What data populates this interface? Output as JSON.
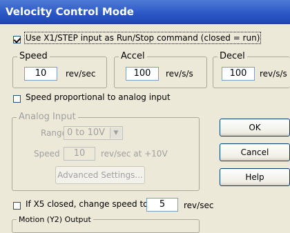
{
  "window": {
    "title": "Velocity Control Mode"
  },
  "run_stop": {
    "label": "Use X1/STEP input as Run/Stop command (closed = run)",
    "checked": true
  },
  "speed": {
    "legend": "Speed",
    "value": "10",
    "unit": "rev/sec"
  },
  "accel": {
    "legend": "Accel",
    "value": "100",
    "unit": "rev/s/s"
  },
  "decel": {
    "legend": "Decel",
    "value": "100",
    "unit": "rev/s/s"
  },
  "speed_analog": {
    "label": "Speed proportional to analog input",
    "checked": false
  },
  "analog_input": {
    "legend": "Analog Input",
    "range_label": "Range",
    "range_value": "0 to 10V",
    "speed_label": "Speed",
    "speed_value": "10",
    "speed_unit": "rev/sec at +10V",
    "advanced_label": "Advanced Settings..."
  },
  "buttons": {
    "ok": "OK",
    "cancel": "Cancel",
    "help": "Help"
  },
  "x5": {
    "label": "If X5 closed, change speed to",
    "value": "5",
    "unit": "rev/sec",
    "checked": false
  },
  "motion_output": {
    "legend": "Motion (Y2) Output"
  }
}
